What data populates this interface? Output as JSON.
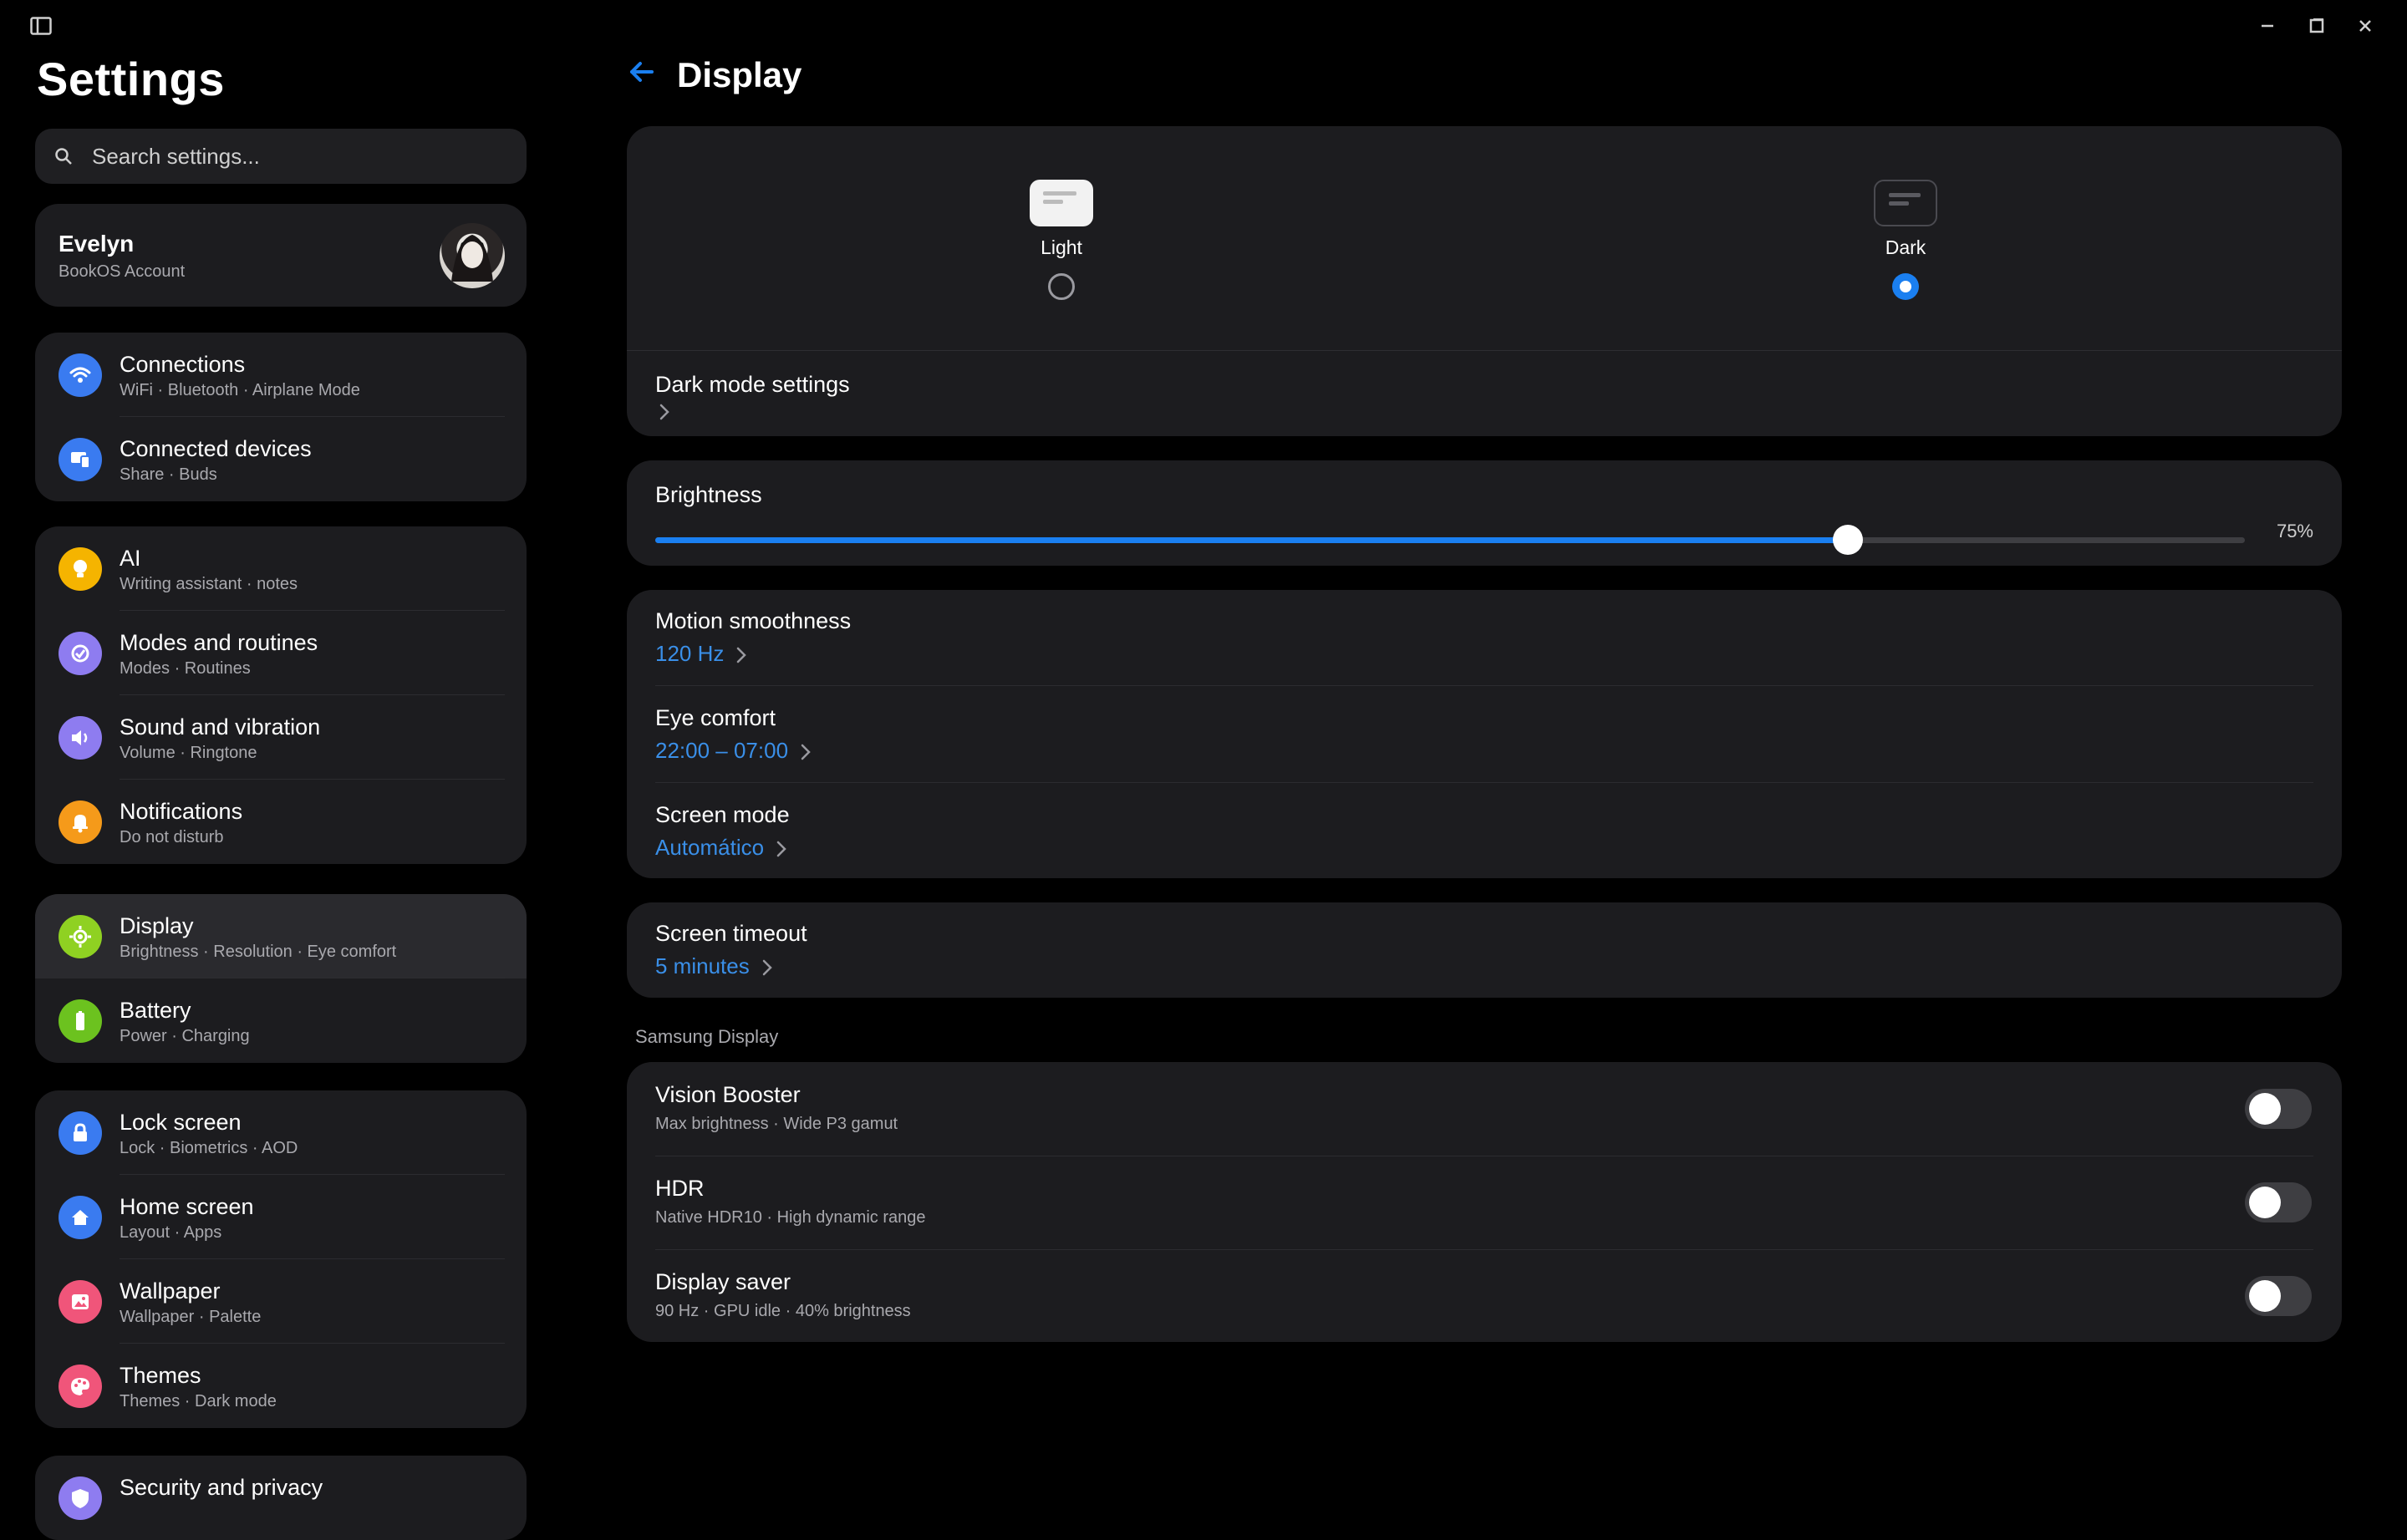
{
  "sidebar": {
    "title": "Settings",
    "search_placeholder": "Search settings...",
    "account": {
      "name": "Evelyn",
      "sub": "BookOS Account"
    },
    "groups": [
      [
        {
          "title": "Connections",
          "sub": "WiFi · Bluetooth · Airplane Mode",
          "icon": "wifi-icon",
          "color": "#3a7bf0"
        },
        {
          "title": "Connected devices",
          "sub": "Share · Buds",
          "icon": "devices-icon",
          "color": "#3a7bf0"
        }
      ],
      [
        {
          "title": "AI",
          "sub": "Writing assistant · notes",
          "icon": "lightbulb-icon",
          "color": "#f5b400"
        },
        {
          "title": "Modes and routines",
          "sub": "Modes · Routines",
          "icon": "routine-icon",
          "color": "#8e7cf0"
        },
        {
          "title": "Sound and vibration",
          "sub": "Volume · Ringtone",
          "icon": "speaker-icon",
          "color": "#8e7cf0"
        },
        {
          "title": "Notifications",
          "sub": "Do not disturb",
          "icon": "bell-icon",
          "color": "#f59a1a"
        }
      ],
      [
        {
          "title": "Display",
          "sub": "Brightness · Resolution · Eye comfort",
          "icon": "sun-gear-icon",
          "color": "#8fd122"
        },
        {
          "title": "Battery",
          "sub": "Power · Charging",
          "icon": "battery-icon",
          "color": "#6cc21f"
        }
      ],
      [
        {
          "title": "Lock screen",
          "sub": "Lock · Biometrics · AOD",
          "icon": "lock-icon",
          "color": "#3a7bf0"
        },
        {
          "title": "Home screen",
          "sub": "Layout · Apps",
          "icon": "home-icon",
          "color": "#3a7bf0"
        },
        {
          "title": "Wallpaper",
          "sub": "Wallpaper · Palette",
          "icon": "image-icon",
          "color": "#f0557a"
        },
        {
          "title": "Themes",
          "sub": "Themes · Dark mode",
          "icon": "palette-icon",
          "color": "#f0557a"
        }
      ],
      [
        {
          "title": "Security and privacy",
          "sub": "",
          "icon": "shield-icon",
          "color": "#8e7cf0"
        }
      ]
    ]
  },
  "main": {
    "title": "Display",
    "theme": {
      "light_label": "Light",
      "dark_label": "Dark",
      "selected": "dark"
    },
    "dark_mode_settings": "Dark mode settings",
    "brightness": {
      "label": "Brightness",
      "value": 0.75,
      "value_text": "75%"
    },
    "motion_smoothness": {
      "label": "Motion smoothness",
      "value": "120 Hz"
    },
    "eye_comfort": {
      "label": "Eye comfort",
      "value": "22:00 – 07:00"
    },
    "screen_mode": {
      "label": "Screen mode",
      "value": "Automático"
    },
    "screen_timeout": {
      "label": "Screen timeout",
      "value": "5 minutes"
    },
    "section_header": "Samsung Display",
    "toggles": [
      {
        "label": "Vision Booster",
        "sub": "Max brightness · Wide P3 gamut",
        "on": false
      },
      {
        "label": "HDR",
        "sub": "Native HDR10 · High dynamic range",
        "on": false
      },
      {
        "label": "Display saver",
        "sub": "90 Hz · GPU idle · 40% brightness",
        "on": false
      }
    ]
  },
  "colors": {
    "accent": "#1a7ff0",
    "link": "#3a8fe8",
    "panel": "#1c1c1f"
  }
}
